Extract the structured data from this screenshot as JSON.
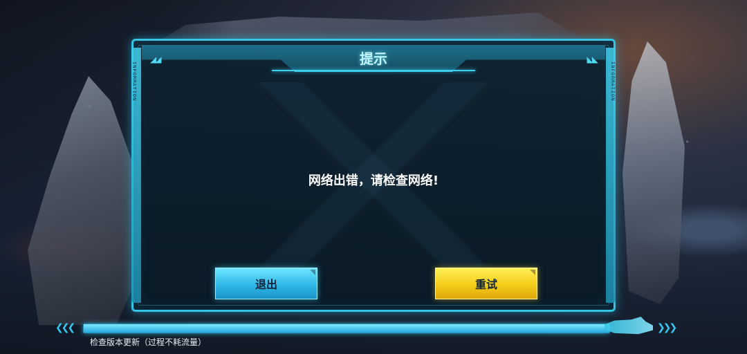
{
  "dialog": {
    "title": "提示",
    "side_label_left": "INFORMATION",
    "side_label_right": "INFORMATION",
    "message": "网络出错，请检查网络!",
    "buttons": {
      "exit_label": "退出",
      "retry_label": "重试"
    }
  },
  "loader": {
    "status_text": "检查版本更新（过程不耗流量）",
    "progress_fraction": 1.0
  },
  "colors": {
    "accent_cyan": "#35c4e4",
    "button_exit": "#2fb8e8",
    "button_retry": "#f4cc18"
  }
}
